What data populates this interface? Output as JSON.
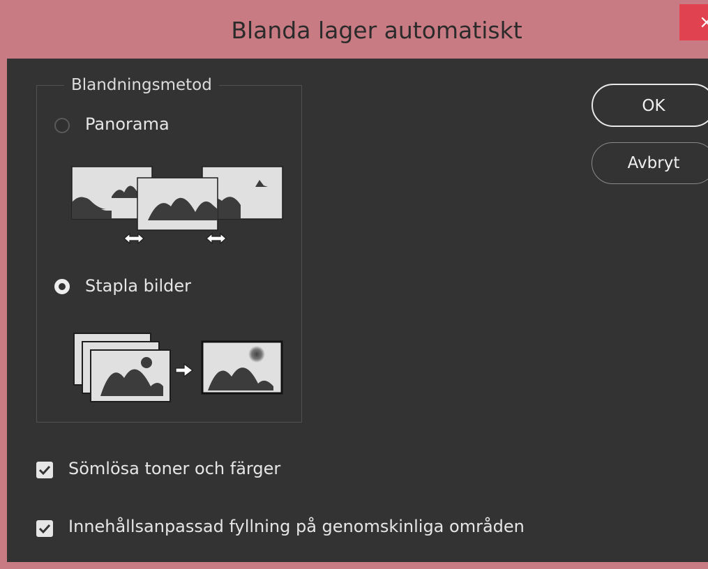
{
  "window": {
    "title": "Blanda lager automatiskt",
    "close_glyph": "×"
  },
  "blend_method": {
    "legend": "Blandningsmetod",
    "options": [
      {
        "label": "Panorama",
        "selected": false,
        "illustration": "panorama-illustration"
      },
      {
        "label": "Stapla bilder",
        "selected": true,
        "illustration": "stack-images-illustration"
      }
    ]
  },
  "buttons": {
    "ok": "OK",
    "cancel": "Avbryt"
  },
  "checkboxes": [
    {
      "label": "Sömlösa toner och färger",
      "checked": true
    },
    {
      "label": "Innehållsanpassad fyllning på genomskinliga områden",
      "checked": true
    }
  ],
  "colors": {
    "titlebar": "#c97b83",
    "background": "#333333",
    "text": "#e6e6e6",
    "close": "#e0434f"
  }
}
